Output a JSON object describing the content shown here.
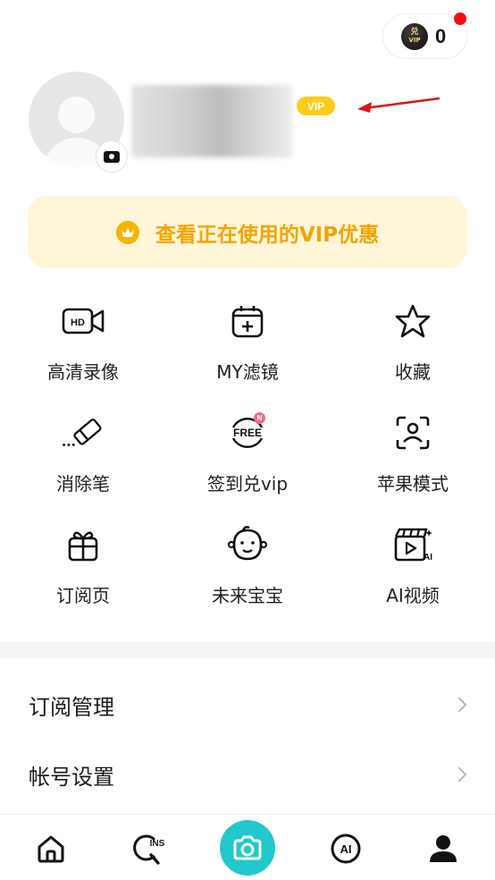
{
  "header": {
    "coin_icon_text_top": "兑",
    "coin_icon_text_bottom": "VIP",
    "coin_count": "0"
  },
  "profile": {
    "vip_badge": "VIP"
  },
  "banner": {
    "text": "查看正在使用的VIP优惠",
    "color": "#f5a300"
  },
  "features": [
    {
      "label": "高清录像",
      "icon": "hd-video-icon"
    },
    {
      "label": "MY滤镜",
      "icon": "filter-add-icon"
    },
    {
      "label": "收藏",
      "icon": "star-icon"
    },
    {
      "label": "消除笔",
      "icon": "eraser-icon"
    },
    {
      "label": "签到兑vip",
      "icon": "free-checkin-icon",
      "badge": "N",
      "icon_text": "FREE"
    },
    {
      "label": "苹果模式",
      "icon": "face-scan-icon"
    },
    {
      "label": "订阅页",
      "icon": "gift-icon"
    },
    {
      "label": "未来宝宝",
      "icon": "baby-face-icon"
    },
    {
      "label": "AI视频",
      "icon": "ai-video-icon",
      "icon_text": "AI"
    }
  ],
  "settings": [
    {
      "label": "订阅管理"
    },
    {
      "label": "帐号设置"
    }
  ],
  "tabbar": {
    "ins_icon_text": "INS",
    "ai_icon_text": "AI",
    "accent": "#21c8cc"
  }
}
